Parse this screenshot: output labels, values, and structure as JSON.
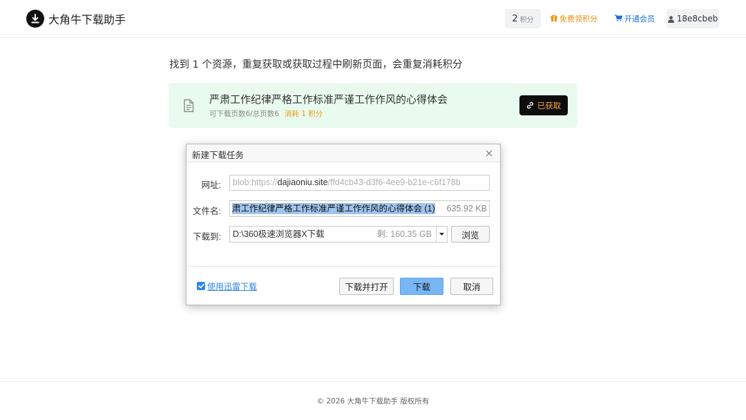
{
  "header": {
    "brand": "大角牛下载助手",
    "points": {
      "value": "2",
      "unit": "积分"
    },
    "free_points_link": "免费领积分",
    "vip_link": "开通会员",
    "username": "18e8cbeb"
  },
  "notice": "找到 1 个资源，重复获取或获取过程中刷新页面，会重复消耗积分",
  "resource": {
    "title": "严肃工作纪律严格工作标准严谨工作作风的心得体会",
    "pages": "可下载页数6/总页数6",
    "cost": "消耗 1 积分",
    "button_label": "已获取"
  },
  "dialog": {
    "title": "新建下载任务",
    "url_label": "网址:",
    "url_prefix": "blob:https://",
    "url_domain": "dajiaoniu.site",
    "url_suffix": "/ffd4cb43-d3f6-4ee9-b21e-c6f178b",
    "filename_label": "文件名:",
    "filename_value": "肃工作纪律严格工作标准严谨工作作风的心得体会 (1)",
    "file_size": "635.92 KB",
    "saveto_label": "下载到:",
    "saveto_path": "D:\\360极速浏览器X下载",
    "free_space": "剩: 160.35 GB",
    "browse_button": "浏览",
    "thunder_checkbox": "使用迅雷下载",
    "thunder_checked": true,
    "download_open_button": "下载并打开",
    "download_button": "下载",
    "cancel_button": "取消"
  },
  "footer": {
    "copyright": "© 2026 大角牛下载助手 版权所有"
  },
  "colors": {
    "accent_orange": "#e69512",
    "link_blue": "#1d6fd6",
    "card_bg": "#e9fbee",
    "primary_button": "#78b6f4"
  }
}
